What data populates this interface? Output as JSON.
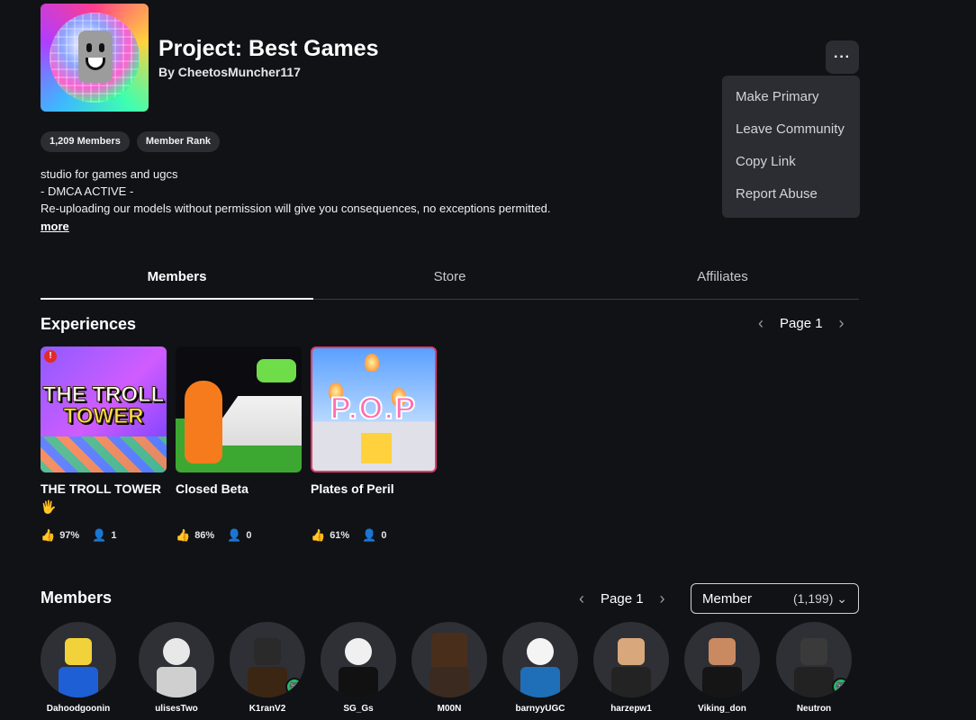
{
  "header": {
    "title": "Project: Best Games",
    "owner": "By CheetosMuncher117",
    "more_label": "···",
    "badges": [
      "1,209 Members",
      "Member Rank"
    ],
    "description": [
      "studio for games and ugcs",
      "- DMCA ACTIVE -",
      "Re-uploading our models without permission will give you consequences, no exceptions permitted."
    ],
    "more_link": "more"
  },
  "menu": {
    "items": [
      "Make Primary",
      "Leave Community",
      "Copy Link",
      "Report Abuse"
    ]
  },
  "tabs": [
    {
      "label": "Members",
      "active": true
    },
    {
      "label": "Store",
      "active": false
    },
    {
      "label": "Affiliates",
      "active": false
    }
  ],
  "experiences": {
    "title": "Experiences",
    "page_label": "Page 1",
    "items": [
      {
        "name": "THE TROLL TOWER 🖐",
        "like": "97%",
        "players": "1",
        "thumb_text_1": "THE TROLL",
        "thumb_text_2": "TOWER"
      },
      {
        "name": "Closed Beta",
        "like": "86%",
        "players": "0"
      },
      {
        "name": "Plates of Peril",
        "like": "61%",
        "players": "0",
        "thumb_text": "P.O.P"
      }
    ]
  },
  "members": {
    "title": "Members",
    "page_label": "Page 1",
    "filter_label": "Member",
    "filter_count": "(1,199)",
    "list": [
      {
        "name": "Dahoodgoonin"
      },
      {
        "name": "ulisesTwo"
      },
      {
        "name": "K1ranV2"
      },
      {
        "name": "SG_Gs"
      },
      {
        "name": "M00N"
      },
      {
        "name": "barnyyUGC"
      },
      {
        "name": "harzepw1"
      },
      {
        "name": "Viking_don"
      },
      {
        "name": "Neutron"
      }
    ]
  }
}
